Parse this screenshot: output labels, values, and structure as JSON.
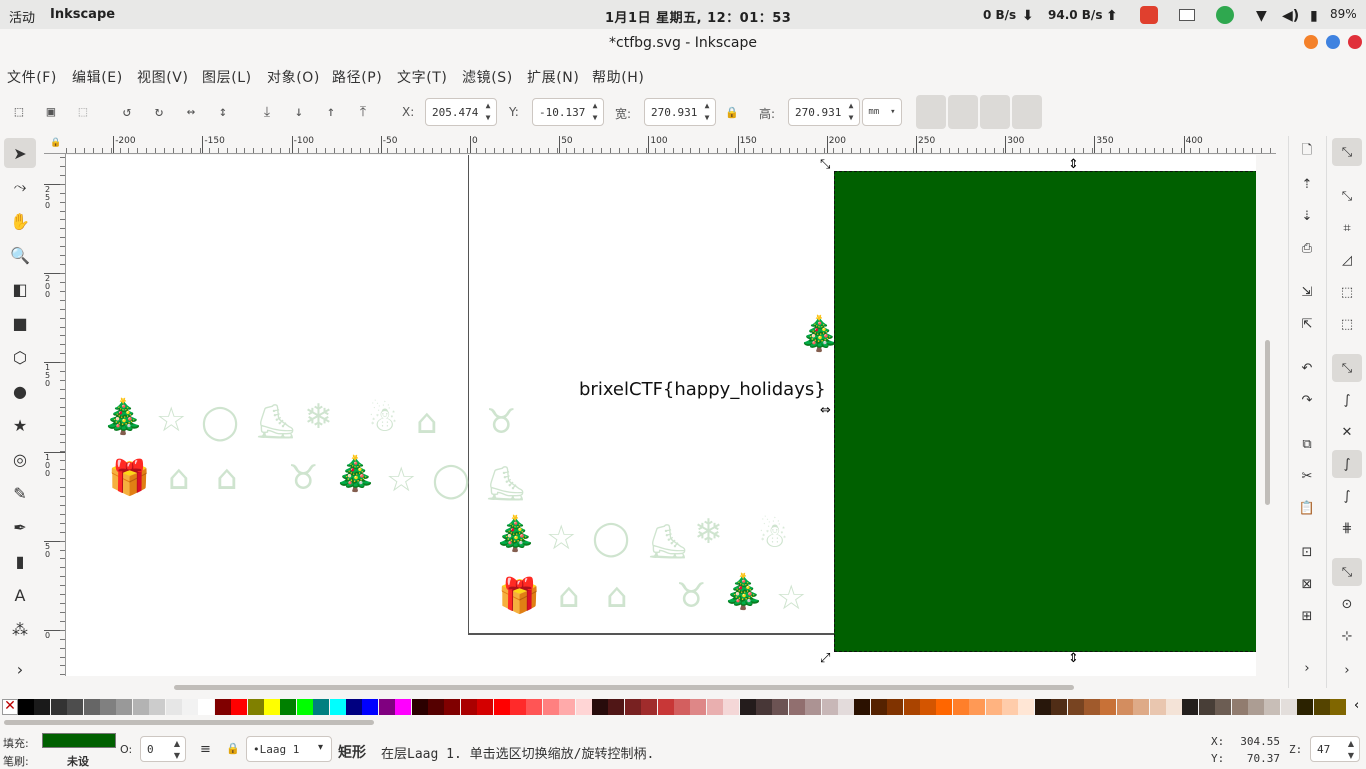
{
  "topbar": {
    "activities": "活动",
    "app_name": "Inkscape",
    "clock": "1月1日 星期五, 12：01：53",
    "download_rate": "0 B/s",
    "upload_rate": "94.0 B/s",
    "battery": "89%"
  },
  "window": {
    "title": "*ctfbg.svg - Inkscape"
  },
  "menu": [
    "文件(F)",
    "编辑(E)",
    "视图(V)",
    "图层(L)",
    "对象(O)",
    "路径(P)",
    "文字(T)",
    "滤镜(S)",
    "扩展(N)",
    "帮助(H)"
  ],
  "toolctl": {
    "x_label": "X:",
    "x_value": "205.474",
    "y_label": "Y:",
    "y_value": "-10.137",
    "w_label": "宽:",
    "w_value": "270.931",
    "h_label": "高:",
    "h_value": "270.931",
    "unit": "mm"
  },
  "hruler_ticks": [
    "-200",
    "-150",
    "-100",
    "-50",
    "0",
    "50",
    "100",
    "150",
    "200",
    "250",
    "300",
    "350",
    "400"
  ],
  "vruler_ticks": [
    "250",
    "200",
    "150",
    "100",
    "50",
    "0"
  ],
  "canvas": {
    "text": "brixelCTF{happy_holidays}",
    "rect_color": "#006000"
  },
  "palette": {
    "colors": [
      "#000000",
      "#1a1a1a",
      "#333333",
      "#4d4d4d",
      "#666666",
      "#808080",
      "#999999",
      "#b3b3b3",
      "#cccccc",
      "#e6e6e6",
      "#f2f2f2",
      "#ffffff",
      "#800000",
      "#ff0000",
      "#808000",
      "#ffff00",
      "#008000",
      "#00ff00",
      "#008080",
      "#00ffff",
      "#000080",
      "#0000ff",
      "#800080",
      "#ff00ff",
      "#2b0000",
      "#550000",
      "#800000",
      "#aa0000",
      "#d40000",
      "#ff0000",
      "#ff2a2a",
      "#ff5555",
      "#ff8080",
      "#ffaaaa",
      "#ffd5d5",
      "#280b0b",
      "#501616",
      "#782121",
      "#a02c2c",
      "#c83737",
      "#d35f5f",
      "#de8787",
      "#e9afaf",
      "#f4d7d7",
      "#241c1c",
      "#483737",
      "#6c5353",
      "#916f6f",
      "#ac9393",
      "#c8b7b7",
      "#e3dbdb",
      "#2b1100",
      "#552200",
      "#803300",
      "#aa4400",
      "#d45500",
      "#ff6600",
      "#ff7f2a",
      "#ff9955",
      "#ffb380",
      "#ffccaa",
      "#ffe6d5",
      "#28170b",
      "#502d16",
      "#784421",
      "#a05a2c",
      "#c87137",
      "#d38d5f",
      "#deaa87",
      "#e9c6af",
      "#f4e3d7",
      "#241f1c",
      "#483e37",
      "#6c5d53",
      "#917c6f",
      "#ac9d93",
      "#c8beb7",
      "#e3dedb",
      "#2b2200",
      "#554400",
      "#806600"
    ]
  },
  "status": {
    "fill_label": "填充:",
    "stroke_label": "笔刷:",
    "stroke_value": "未设",
    "fill_color": "#006000",
    "opacity_label": "O:",
    "opacity_value": "0",
    "layer": "•Laag 1",
    "object_type": "矩形",
    "message": "在层Laag 1. 单击选区切换缩放/旋转控制柄.",
    "cursor_x_label": "X:",
    "cursor_x": "304.55",
    "cursor_y_label": "Y:",
    "cursor_y": "70.37",
    "zoom_label": "Z:",
    "zoom": "47"
  }
}
